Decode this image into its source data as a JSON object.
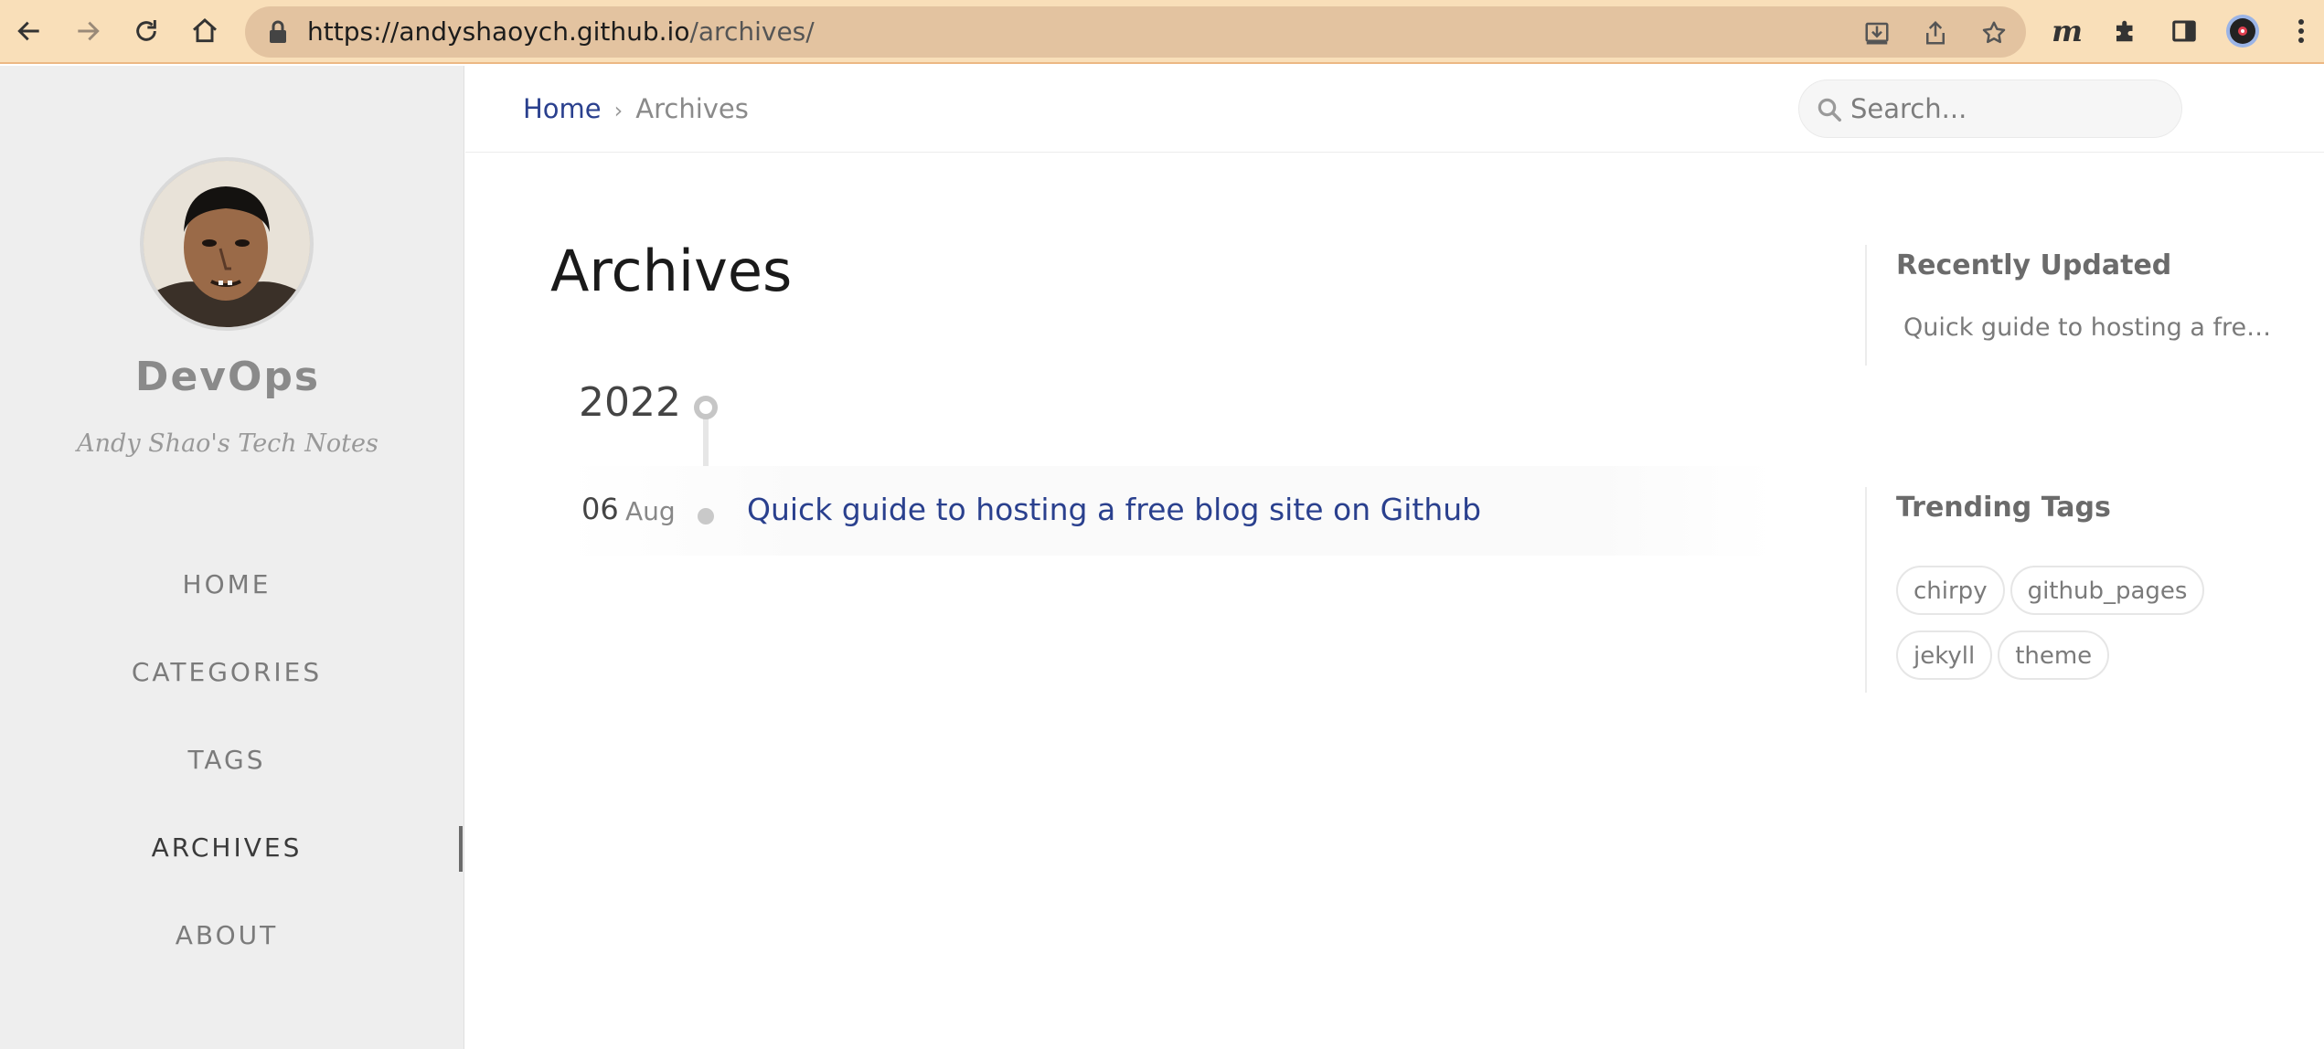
{
  "browser": {
    "url_host": "https://andyshaoych.github.io",
    "url_path": "/archives/",
    "extension_label": "m"
  },
  "sidebar": {
    "site_title": "DevOps",
    "site_subtitle": "Andy Shao's Tech Notes",
    "nav": [
      {
        "label": "HOME",
        "active": false
      },
      {
        "label": "CATEGORIES",
        "active": false
      },
      {
        "label": "TAGS",
        "active": false
      },
      {
        "label": "ARCHIVES",
        "active": true
      },
      {
        "label": "ABOUT",
        "active": false
      }
    ]
  },
  "topbar": {
    "breadcrumb": {
      "home": "Home",
      "separator": "›",
      "current": "Archives"
    },
    "search_placeholder": "Search..."
  },
  "main": {
    "title": "Archives",
    "year": "2022",
    "posts": [
      {
        "day": "06",
        "month": "Aug",
        "title": "Quick guide to hosting a free blog site on Github"
      }
    ]
  },
  "panel": {
    "recently_updated": {
      "heading": "Recently Updated",
      "items": [
        "Quick guide to hosting a free blog site on Github"
      ]
    },
    "trending_tags": {
      "heading": "Trending Tags",
      "tags": [
        "chirpy",
        "github_pages",
        "jekyll",
        "theme"
      ]
    }
  },
  "colors": {
    "chrome_bg": "#f9dfb9",
    "sidebar_bg": "#eeeeee",
    "link": "#2a408e"
  },
  "icons": [
    "back-arrow-icon",
    "forward-arrow-icon",
    "reload-icon",
    "home-icon",
    "lock-icon",
    "install-icon",
    "share-icon",
    "star-icon",
    "puzzle-icon",
    "side-panel-icon",
    "profile-icon",
    "kebab-menu-icon",
    "search-icon"
  ]
}
